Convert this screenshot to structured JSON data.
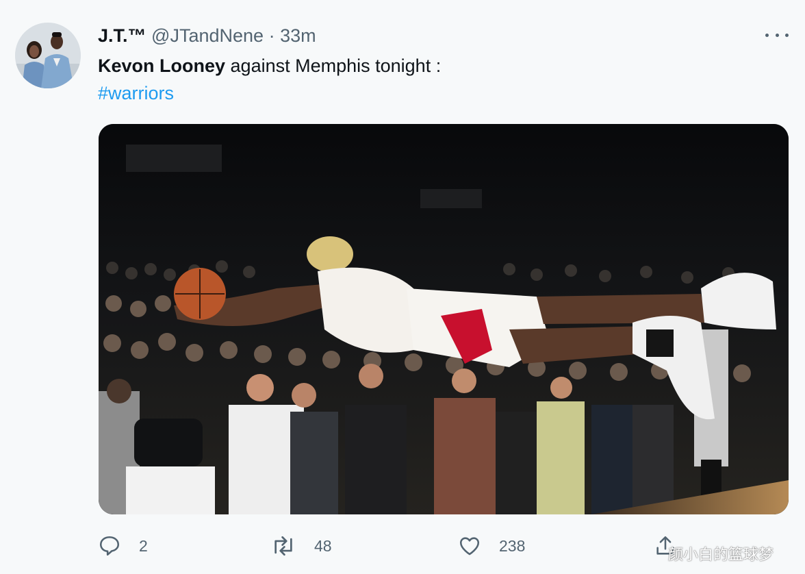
{
  "tweet": {
    "display_name": "J.T.™",
    "handle": "@JTandNene",
    "separator": "·",
    "time": "33m",
    "text_bold": "Kevon Looney",
    "text_rest": " against Memphis tonight :",
    "hashtag": "#warriors"
  },
  "actions": {
    "reply_count": "2",
    "retweet_count": "48",
    "like_count": "238"
  },
  "watermark": "颜小白的篮球梦",
  "colors": {
    "link": "#1d9bf0",
    "secondary_text": "#536471",
    "jersey_red": "#c8102e"
  },
  "icons": [
    "more-icon",
    "reply-icon",
    "retweet-icon",
    "like-icon",
    "share-icon"
  ]
}
